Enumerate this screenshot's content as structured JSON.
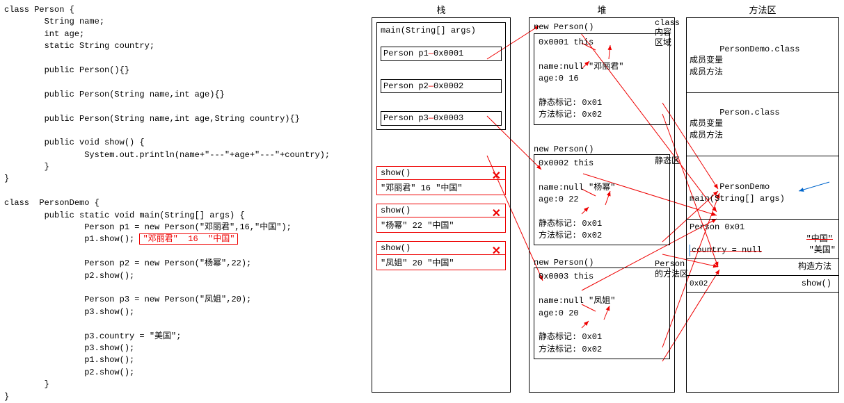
{
  "code": {
    "class_person": "class Person {",
    "field1": "        String name;",
    "field2": "        int age;",
    "field3": "        static String country;",
    "ctor1": "        public Person(){}",
    "ctor2": "        public Person(String name,int age){}",
    "ctor3": "        public Person(String name,int age,String country){}",
    "show1": "        public void show() {",
    "show2": "                System.out.println(name+\"---\"+age+\"---\"+country);",
    "show3": "        }",
    "close1": "}",
    "class_demo": "class  PersonDemo {",
    "main1": "        public static void main(String[] args) {",
    "main_p1": "                Person p1 = new Person(\"邓丽君\",16,\"中国\");",
    "main_p1s": "                p1.show(); ",
    "annot_p1": "\"邓丽君\"  16  \"中国\"",
    "main_p2": "                Person p2 = new Person(\"杨幂\",22);",
    "main_p2s": "                p2.show();",
    "main_p3": "                Person p3 = new Person(\"凤姐\",20);",
    "main_p3s": "                p3.show();",
    "main_set": "                p3.country = \"美国\";",
    "main_sa": "                p3.show();",
    "main_sb": "                p1.show();",
    "main_sc": "                p2.show();",
    "main_close": "        }",
    "close2": "}"
  },
  "columns": {
    "stack": "栈",
    "heap": "堆",
    "method": "方法区"
  },
  "stack": {
    "main": "main(String[] args)",
    "p1a": "Person p1",
    "p1b": "0x0001",
    "p2a": "Person p2",
    "p2b": "0x0002",
    "p3a": "Person p3",
    "p3b": "0x0003",
    "show": "show()",
    "s1": "\"邓丽君\"   16  \"中国\"",
    "s2": "\"杨幂\"    22  \"中国\"",
    "s3": "\"凤姐\"    20  \"中国\""
  },
  "heap": {
    "new": "new Person()",
    "o1": {
      "addr": "0x0001   this",
      "name": "name:null \"邓丽君\"",
      "age": "age:0   16",
      "static": "静态标记:   0x01",
      "method": "方法标记:   0x02"
    },
    "o2": {
      "addr": "0x0002  this",
      "name": "name:null \"杨幂\"",
      "age": "age:0   22",
      "static": "静态标记:   0x01",
      "method": "方法标记:   0x02"
    },
    "o3": {
      "addr": "0x0003  this",
      "name": "name:null \"凤姐\"",
      "age": "age:0   20",
      "static": "静态标记:   0x01",
      "method": "方法标记:   0x02"
    }
  },
  "method_area": {
    "labelA": "class\n内容\n区域",
    "labelB": "静态区",
    "labelC": "Person\n的方法区",
    "secA1": "PersonDemo.class\n成员变量\n成员方法",
    "secA2": "Person.class\n成员变量\n成员方法",
    "secB1": "PersonDemo\nmain(String[] args)",
    "secB2_head": "Person    0x01",
    "secB2_val": "country = null",
    "secB2_old": "\"中国\"",
    "secB2_new": "\"美国\"",
    "secC1": "构造方法",
    "secC2": "show()",
    "code02": "0x02"
  }
}
